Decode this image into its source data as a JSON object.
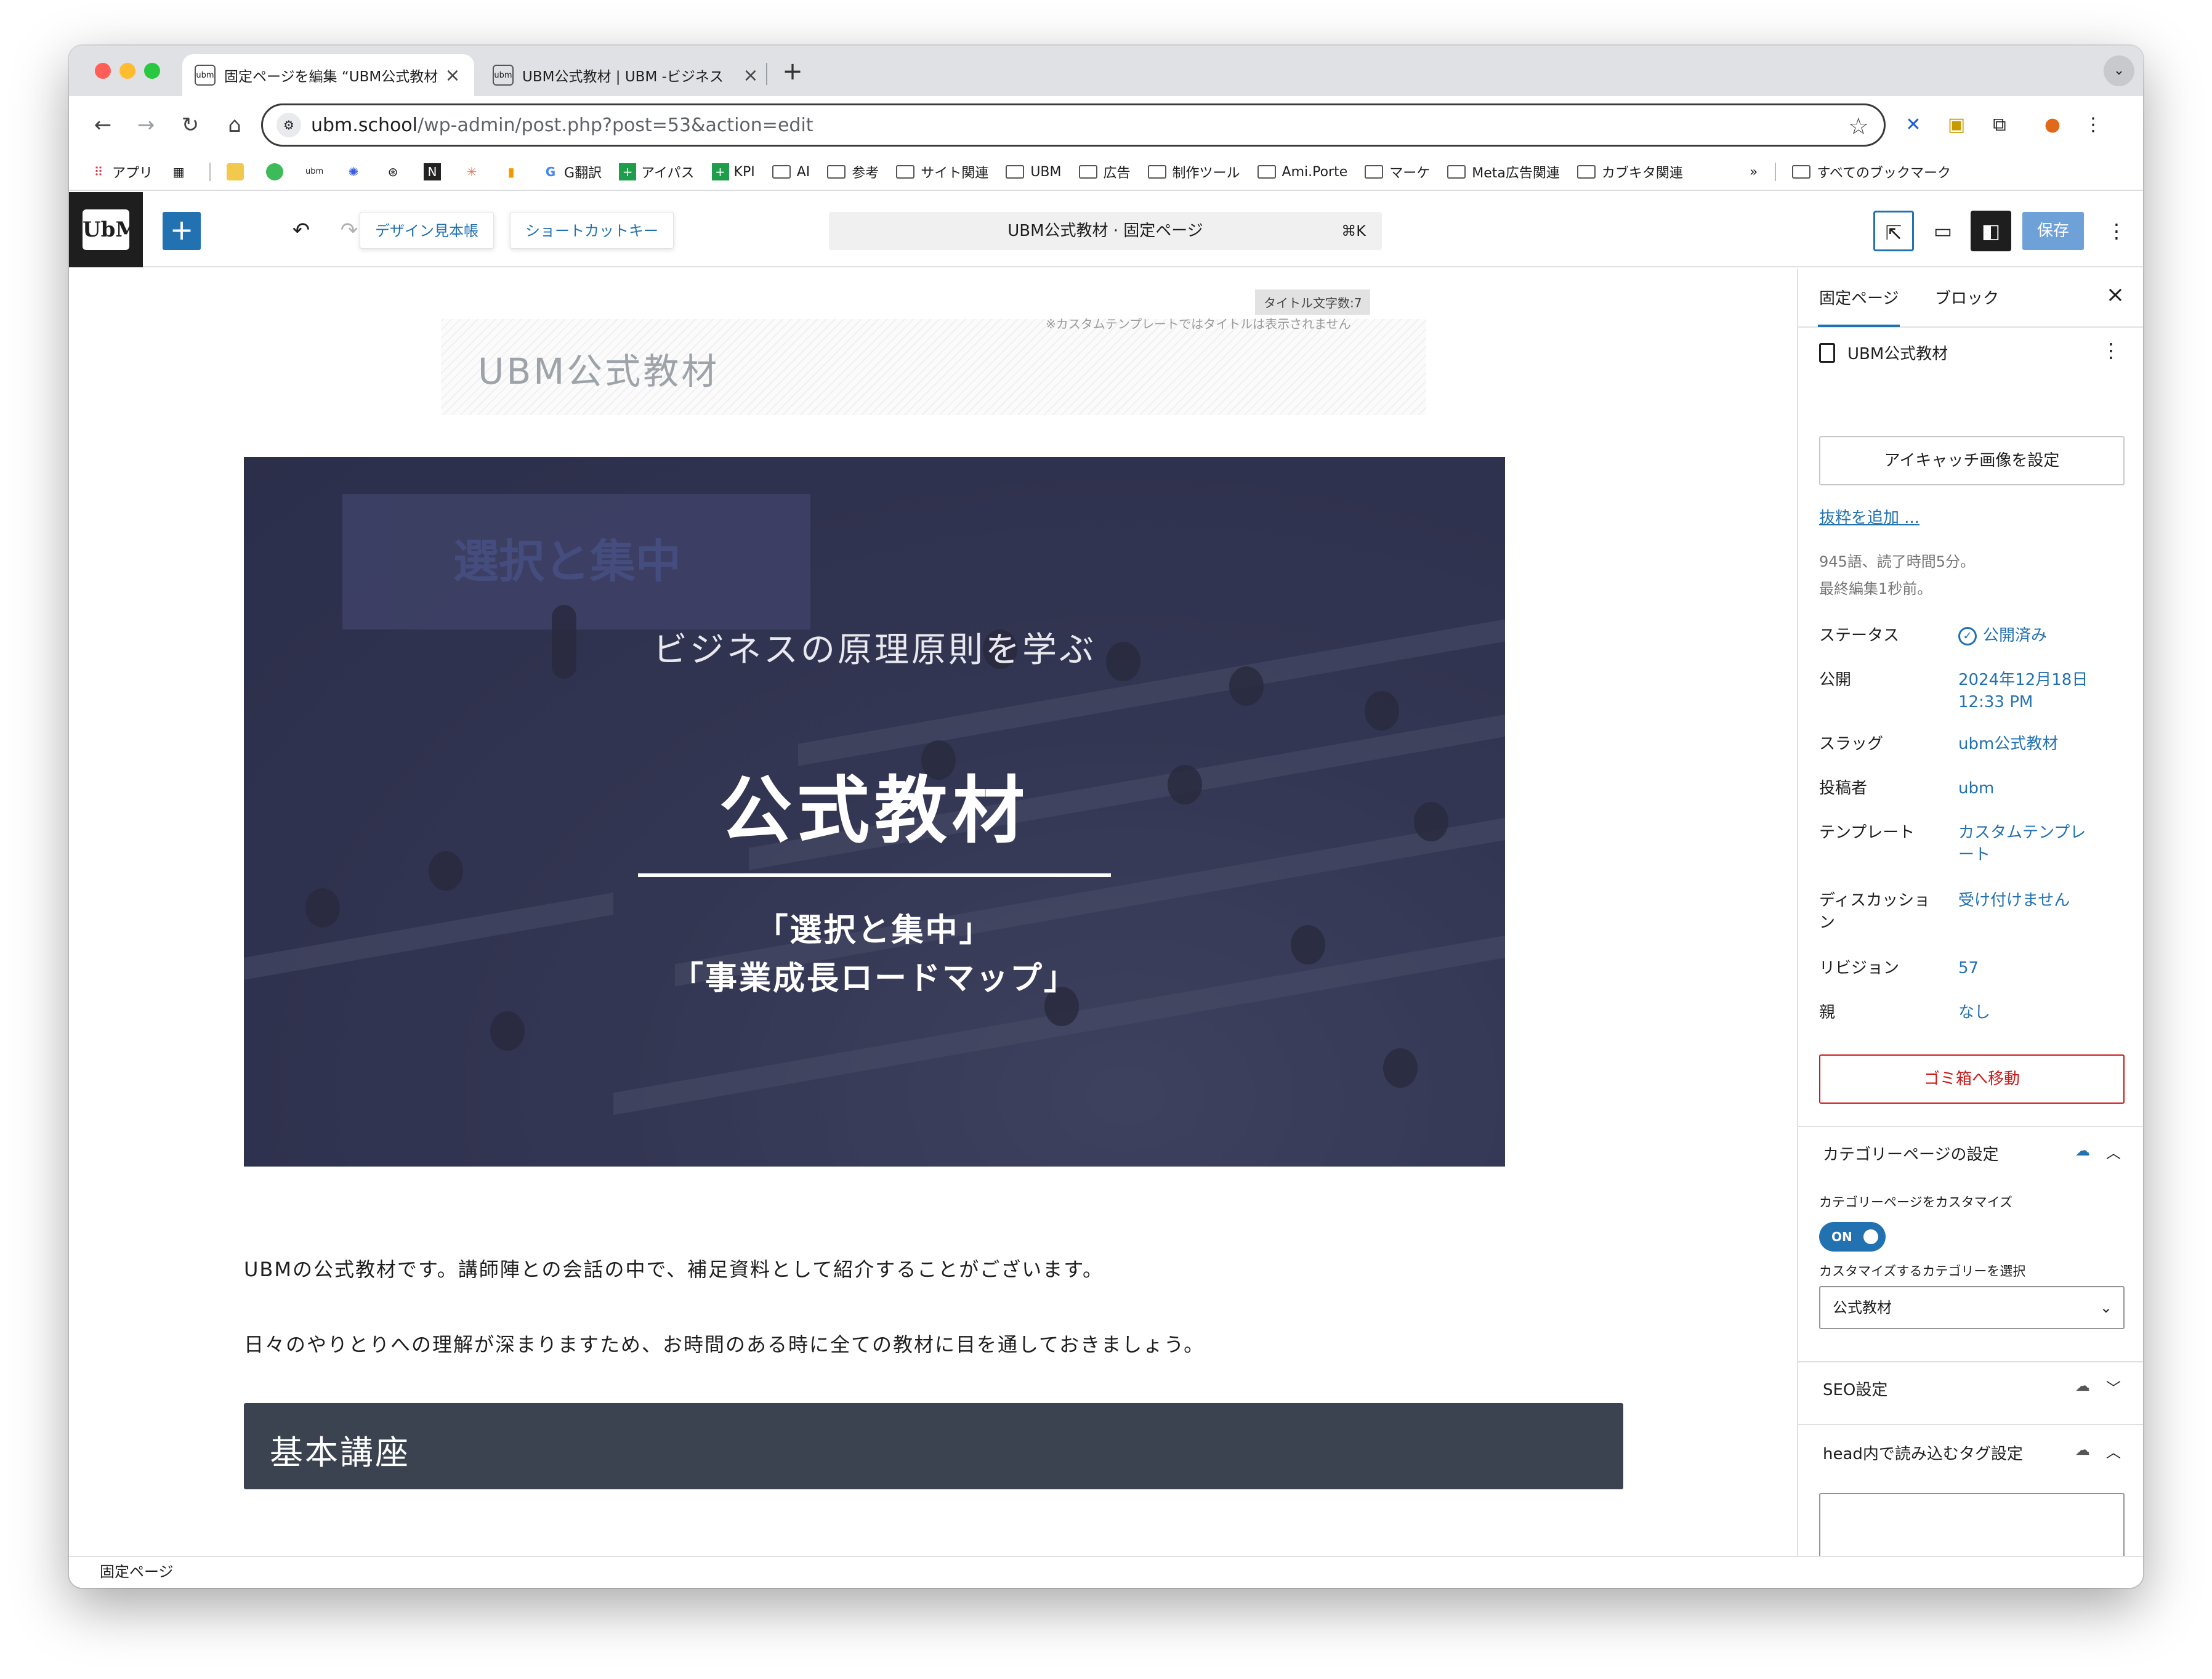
{
  "browser": {
    "tabs": [
      {
        "title": "固定ページを編集 “UBM公式教材",
        "favicon": "ubm",
        "active": true
      },
      {
        "title": "UBM公式教材 | UBM -ビジネス",
        "favicon": "ubm",
        "active": false
      }
    ],
    "tab_close": "×",
    "new_tab": "+",
    "url_host": "ubm.school",
    "url_path": "/wp-admin/post.php?post=53&action=edit",
    "bookmarks": [
      {
        "label": "アプリ",
        "icon": "apps-grid-icon"
      },
      {
        "label": "",
        "icon": "grid-icon"
      },
      {
        "label": "",
        "icon": "bookmark-icon-yellow"
      },
      {
        "label": "",
        "icon": "bookmark-icon-green"
      },
      {
        "label": "",
        "icon": "ubm-icon"
      },
      {
        "label": "",
        "icon": "flower-icon"
      },
      {
        "label": "",
        "icon": "chatgpt-icon"
      },
      {
        "label": "",
        "icon": "notion-icon"
      },
      {
        "label": "",
        "icon": "claude-icon"
      },
      {
        "label": "",
        "icon": "analytics-icon"
      },
      {
        "label": "G翻訳",
        "icon": "google-icon"
      },
      {
        "label": "アイパス",
        "icon": "sheet-icon"
      },
      {
        "label": "KPI",
        "icon": "sheet-icon"
      },
      {
        "label": "AI",
        "icon": "folder-icon"
      },
      {
        "label": "参考",
        "icon": "folder-icon"
      },
      {
        "label": "サイト関連",
        "icon": "folder-icon"
      },
      {
        "label": "UBM",
        "icon": "folder-icon"
      },
      {
        "label": "広告",
        "icon": "folder-icon"
      },
      {
        "label": "制作ツール",
        "icon": "folder-icon"
      },
      {
        "label": "Ami.Porte",
        "icon": "folder-icon"
      },
      {
        "label": "マーケ",
        "icon": "folder-icon"
      },
      {
        "label": "Meta広告関連",
        "icon": "folder-icon"
      },
      {
        "label": "カブキタ関連",
        "icon": "folder-icon"
      }
    ],
    "bookmarks_more": "»",
    "all_bookmarks": "すべてのブックマーク"
  },
  "editor_header": {
    "logo": "UbM",
    "inserter": "+",
    "pattern_button": "デザイン見本帳",
    "shortcut_button": "ショートカットキー",
    "command_title": "UBM公式教材 · 固定ページ",
    "command_key": "⌘K",
    "save_button": "保存"
  },
  "canvas": {
    "title_count": "タイトル文字数:7",
    "title_note": "※カスタムテンプレートではタイトルは表示されません",
    "page_title": "UBM公式教材",
    "hero": {
      "screen_text": "選択と集中",
      "subtitle": "ビジネスの原理原則を学ぶ",
      "title": "公式教材",
      "line1": "「選択と集中」",
      "line2": "「事業成長ロードマップ」"
    },
    "paragraph1": "UBMの公式教材です。講師陣との会話の中で、補足資料として紹介することがございます。",
    "paragraph2": "日々のやりとりへの理解が深まりますため、お時間のある時に全ての教材に目を通しておきましょう。",
    "heading": "基本講座"
  },
  "sidebar": {
    "tab_page": "固定ページ",
    "tab_block": "ブロック",
    "close": "×",
    "page_name": "UBM公式教材",
    "featured_image_button": "アイキャッチ画像を設定",
    "excerpt_link": "抜粋を追加 ...",
    "word_count": "945語、読了時間5分。",
    "last_edited": "最終編集1秒前。",
    "fields": [
      {
        "label": "ステータス",
        "value": "公開済み"
      },
      {
        "label": "公開",
        "value": "2024年12月18日 12:33 PM"
      },
      {
        "label": "スラッグ",
        "value": "ubm公式教材"
      },
      {
        "label": "投稿者",
        "value": "ubm"
      },
      {
        "label": "テンプレート",
        "value": "カスタムテンプレート"
      },
      {
        "label": "ディスカッション",
        "value": "受け付けません"
      },
      {
        "label": "リビジョン",
        "value": "57"
      },
      {
        "label": "親",
        "value": "なし"
      }
    ],
    "trash_button": "ゴミ箱へ移動",
    "category_panel": {
      "title": "カテゴリーページの設定",
      "customize_label": "カテゴリーページをカスタマイズ",
      "toggle": "ON",
      "select_label": "カスタマイズするカテゴリーを選択",
      "select_value": "公式教材"
    },
    "seo_panel": {
      "title": "SEO設定"
    },
    "head_panel": {
      "title": "head内で読み込むタグ設定"
    }
  },
  "footer": {
    "breadcrumb": "固定ページ"
  },
  "colors": {
    "accent": "#2271b1",
    "danger": "#cc1818",
    "heading_bg": "#3b4350"
  }
}
